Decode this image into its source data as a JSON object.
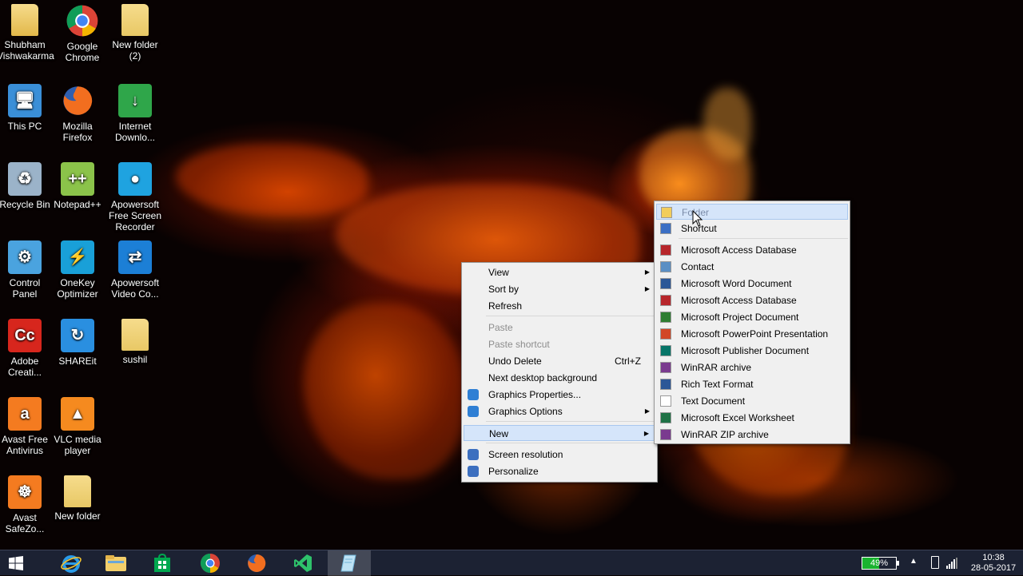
{
  "desktop_icons": [
    {
      "label": "Shubham\nVishwakarma",
      "icon": "user-folder-icon",
      "color": "#e2b84a"
    },
    {
      "label": "Google\nChrome",
      "icon": "chrome-icon",
      "color": "#db4437"
    },
    {
      "label": "New folder\n(2)",
      "icon": "folder-icon",
      "color": "#e8c865"
    },
    {
      "label": "This PC",
      "icon": "computer-icon",
      "color": "#3a8fd8"
    },
    {
      "label": "Mozilla\nFirefox",
      "icon": "firefox-icon",
      "color": "#e66000"
    },
    {
      "label": "Internet\nDownlo...",
      "icon": "idm-icon",
      "color": "#2fa64a"
    },
    {
      "label": "Recycle Bin",
      "icon": "recycle-bin-icon",
      "color": "#9bb3c9"
    },
    {
      "label": "Notepad++",
      "icon": "notepad-plus-icon",
      "color": "#8bc34a"
    },
    {
      "label": "Apowersoft\nFree Screen\nRecorder",
      "icon": "screen-recorder-icon",
      "color": "#1fa3e0"
    },
    {
      "label": "Control\nPanel",
      "icon": "control-panel-icon",
      "color": "#4aa3df"
    },
    {
      "label": "OneKey\nOptimizer",
      "icon": "onekey-optimizer-icon",
      "color": "#19a0d8"
    },
    {
      "label": "Apowersoft\nVideo Co...",
      "icon": "video-converter-icon",
      "color": "#1c7fd6"
    },
    {
      "label": "Adobe\nCreati...",
      "icon": "adobe-cc-icon",
      "color": "#d7261d"
    },
    {
      "label": "SHAREit",
      "icon": "shareit-icon",
      "color": "#2a8fe0"
    },
    {
      "label": "sushil",
      "icon": "folder-icon",
      "color": "#e8c865"
    },
    {
      "label": "Avast Free\nAntivirus",
      "icon": "avast-icon",
      "color": "#f47b20"
    },
    {
      "label": "VLC media\nplayer",
      "icon": "vlc-icon",
      "color": "#f58a1f"
    },
    {
      "label": "Avast\nSafeZo...",
      "icon": "avast-safezone-icon",
      "color": "#f47b20"
    },
    {
      "label": "New folder",
      "icon": "folder-icon",
      "color": "#e8c865"
    }
  ],
  "context_menu": {
    "items": [
      {
        "label": "View",
        "submenu": true
      },
      {
        "label": "Sort by",
        "submenu": true
      },
      {
        "label": "Refresh"
      },
      {
        "label": "Paste",
        "disabled": true
      },
      {
        "label": "Paste shortcut",
        "disabled": true
      },
      {
        "label": "Undo Delete",
        "shortcut": "Ctrl+Z"
      },
      {
        "label": "Next desktop background"
      },
      {
        "label": "Graphics Properties...",
        "icon": "graphics-icon"
      },
      {
        "label": "Graphics Options",
        "icon": "graphics-icon",
        "submenu": true
      },
      {
        "label": "New",
        "submenu": true,
        "highlighted": true
      },
      {
        "label": "Screen resolution",
        "icon": "display-icon"
      },
      {
        "label": "Personalize",
        "icon": "personalize-icon"
      }
    ]
  },
  "new_submenu": {
    "items": [
      {
        "label": "Folder",
        "icon": "folder-icon",
        "highlighted": true
      },
      {
        "label": "Shortcut",
        "icon": "shortcut-icon"
      },
      {
        "label": "Microsoft Access Database",
        "icon": "access-icon"
      },
      {
        "label": "Contact",
        "icon": "contact-icon"
      },
      {
        "label": "Microsoft Word Document",
        "icon": "word-icon"
      },
      {
        "label": "Microsoft Access Database",
        "icon": "access-icon"
      },
      {
        "label": "Microsoft Project Document",
        "icon": "project-icon"
      },
      {
        "label": "Microsoft PowerPoint Presentation",
        "icon": "powerpoint-icon"
      },
      {
        "label": "Microsoft Publisher Document",
        "icon": "publisher-icon"
      },
      {
        "label": "WinRAR archive",
        "icon": "winrar-icon"
      },
      {
        "label": "Rich Text Format",
        "icon": "rtf-icon"
      },
      {
        "label": "Text Document",
        "icon": "text-doc-icon"
      },
      {
        "label": "Microsoft Excel Worksheet",
        "icon": "excel-icon"
      },
      {
        "label": "WinRAR ZIP archive",
        "icon": "winrar-zip-icon"
      }
    ]
  },
  "taskbar": {
    "apps": [
      "start-icon",
      "internet-explorer-icon",
      "file-explorer-icon",
      "store-icon",
      "chrome-icon",
      "firefox-icon",
      "visual-studio-icon",
      "notepad-icon"
    ],
    "battery_percent": "49%",
    "time": "10:38",
    "date": "28-05-2017"
  },
  "colors": {
    "menu_bg": "#f0f0f0",
    "highlight": "#d5e5fa",
    "taskbar": "#1c2233"
  }
}
